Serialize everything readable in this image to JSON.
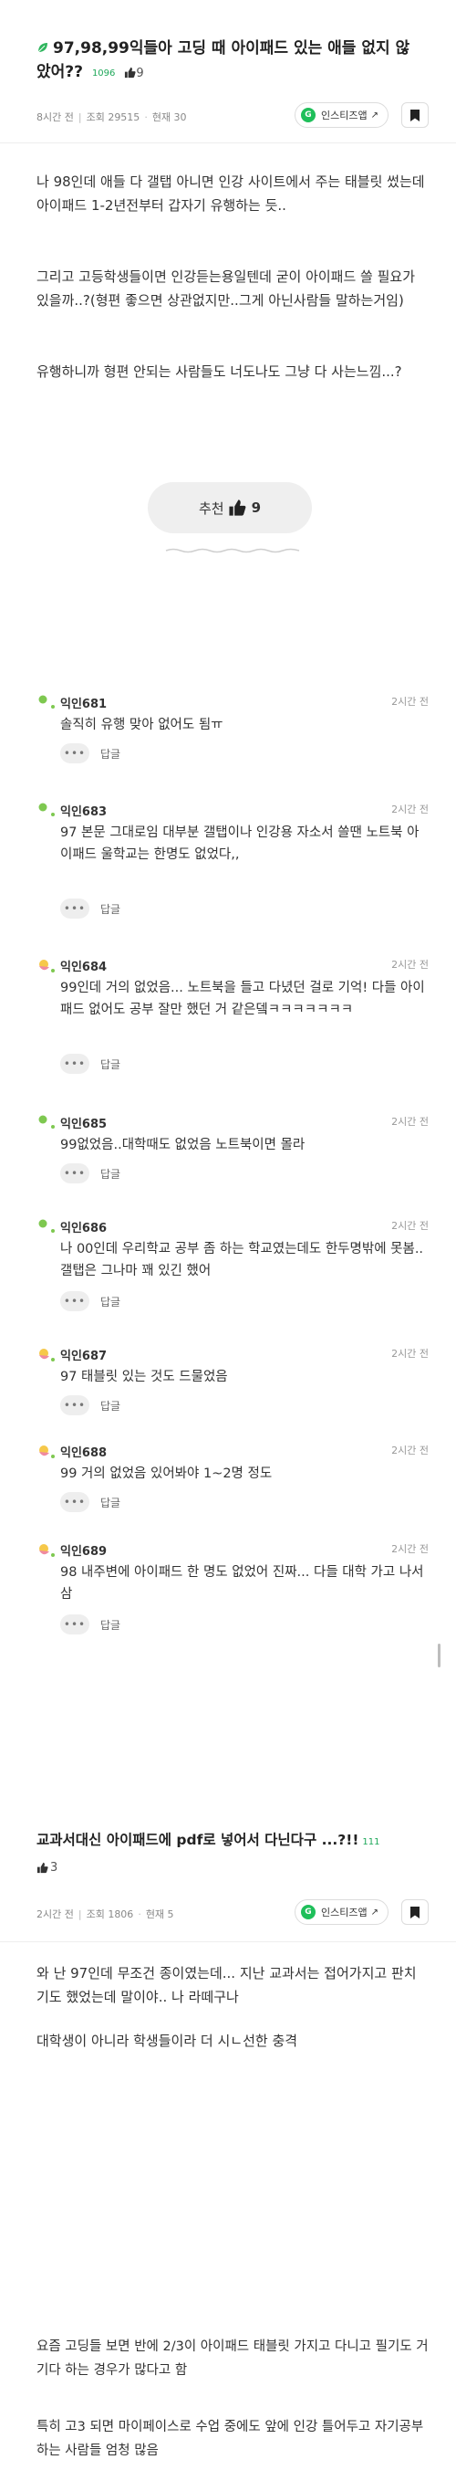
{
  "post1": {
    "title": "97,98,99익들아 고딩 때 아이패드 있는 애들 없지 않았어??",
    "title_meta": "1096",
    "like_count": "9",
    "time": "8시간 전",
    "views": "조회 29515",
    "comments_count": "현재 30",
    "insta_label": "인스티즈앱",
    "paragraphs": [
      "나 98인데 애들 다 갤탭 아니면 인강 사이트에서 주는 태블릿 썼는데 아이패드 1-2년전부터 갑자기 유행하는 듯..",
      "그리고 고등학생들이면 인강듣는용일텐데 굳이 아이패드 쓸 필요가 있을까..?(형편 좋으면 상관없지만..그게 아닌사람들 말하는거임)",
      "유행하니까 형편 안되는 사람들도 너도나도 그냥 다 사는느낌...?"
    ],
    "recommend_label": "추천",
    "recommend_count": "9"
  },
  "comments": [
    {
      "name": "익인681",
      "time": "2시간 전",
      "text": "솔직히 유행 맞아 없어도 됨ㅠ",
      "more": "•••",
      "reply": "답글",
      "color": "#7ec850"
    },
    {
      "name": "익인683",
      "time": "2시간 전",
      "text": "97 본문 그대로임 대부분 갤탭이나 인강용 자소서 쓸땐 노트북 아이패드 울학교는 한명도 없었다,,",
      "more": "•••",
      "reply": "답글",
      "color": "#7ec850"
    },
    {
      "name": "익인684",
      "time": "2시간 전",
      "text": "99인데 거의 없었음... 노트북을 들고 다녔던 걸로 기억! 다들 아이패드 없어도 공부 잘만 했던 거 같은뎈ㅋㅋㅋㅋㅋㅋㅋ",
      "more": "•••",
      "reply": "답글",
      "color": "#f0a84a"
    },
    {
      "name": "익인685",
      "time": "2시간 전",
      "text": "99없었음..대학때도 없었음 노트북이면 몰라",
      "more": "•••",
      "reply": "답글",
      "color": "#7ec850"
    },
    {
      "name": "익인686",
      "time": "2시간 전",
      "text": "나 00인데 우리학교 공부 좀 하는 학교였는데도 한두명밖에 못봄.. 갤탭은 그나마 꽤 있긴 했어",
      "more": "•••",
      "reply": "답글",
      "color": "#7ec850"
    },
    {
      "name": "익인687",
      "time": "2시간 전",
      "text": "97 태블릿 있는 것도 드물었음",
      "more": "•••",
      "reply": "답글",
      "color": "#f0a84a"
    },
    {
      "name": "익인688",
      "time": "2시간 전",
      "text": "99 거의 없었음 있어봐야 1~2명 정도",
      "more": "•••",
      "reply": "답글",
      "color": "#f0a84a"
    },
    {
      "name": "익인689",
      "time": "2시간 전",
      "text": "98 내주변에 아이패드 한 명도 없었어 진짜... 다들 대학 가고 나서 삼",
      "more": "•••",
      "reply": "답글",
      "color": "#f0a84a"
    }
  ],
  "post2": {
    "title": "교과서대신 아이패드에 pdf로 넣어서 다닌다구 ...?!!",
    "title_meta": "111",
    "like_count": "3",
    "time": "2시간 전",
    "views": "조회 1806",
    "comments_count": "현재 5",
    "insta_label": "인스티즈앱",
    "paragraphs": [
      "와 난 97인데 무조건 종이였는데... 지난 교과서는 접어가지고 판치기도 했었는데 말이야.. 나 라떼구나",
      "대학생이 아니라 학생들이라 더 시ㄴ선한 충격"
    ]
  },
  "tail": {
    "paragraphs": [
      "요즘 고딩들 보면 반에 2/3이 아이패드 태블릿 가지고 다니고 필기도 거기다 하는 경우가 많다고 함",
      "특히 고3 되면 마이페이스로 수업 중에도 앞에 인강 틀어두고 자기공부 하는 사람들 엄청 많음"
    ]
  }
}
